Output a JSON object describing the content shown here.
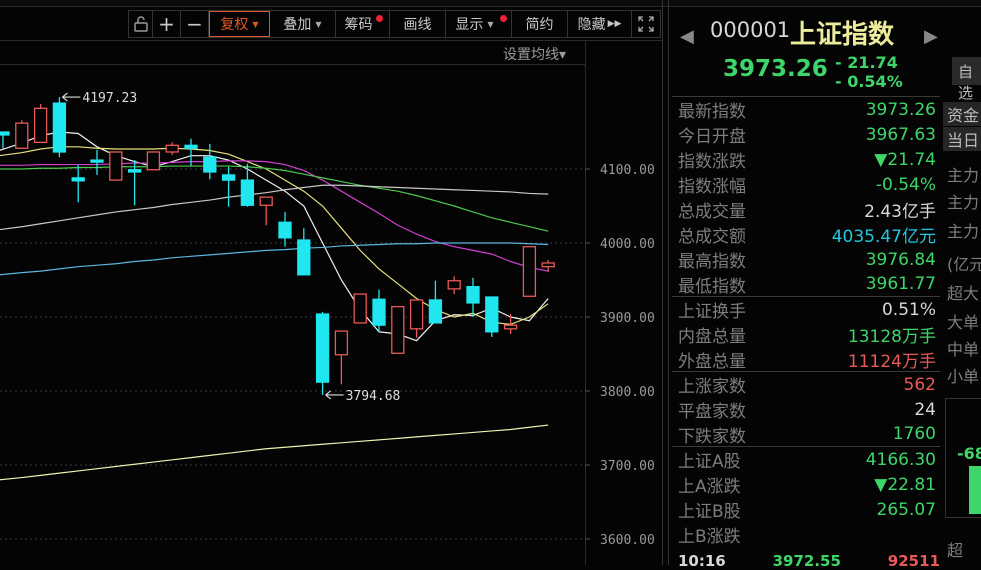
{
  "toolbar": {
    "lock_icon": "unlock-icon",
    "zoom_in": "+",
    "zoom_out": "−",
    "fuquan": "复权",
    "diejia": "叠加",
    "chouma": "筹码",
    "huaxian": "画线",
    "xianshi": "显示",
    "jianyue": "简约",
    "yincang": "隐藏",
    "fullscreen_icon": "expand-icon"
  },
  "set_ma": "设置均线▾",
  "quote": {
    "code": "000001",
    "name": "上证指数",
    "price": "3973.26",
    "change": "- 21.74",
    "change_pct": "- 0.54%",
    "zixuan": "自选"
  },
  "stats": [
    {
      "k": "最新指数",
      "v": "3973.26",
      "c": "g"
    },
    {
      "k": "今日开盘",
      "v": "3967.63",
      "c": "g"
    },
    {
      "k": "指数涨跌",
      "v": "▼21.74",
      "c": "g"
    },
    {
      "k": "指数涨幅",
      "v": "-0.54%",
      "c": "g"
    },
    {
      "k": "总成交量",
      "v": "2.43亿手",
      "c": "w"
    },
    {
      "k": "总成交额",
      "v": "4035.47亿元",
      "c": "c"
    },
    {
      "k": "最高指数",
      "v": "3976.84",
      "c": "g"
    },
    {
      "k": "最低指数",
      "v": "3961.77",
      "c": "g"
    },
    {
      "k": "上证换手",
      "v": "0.51%",
      "c": "w"
    },
    {
      "k": "内盘总量",
      "v": "13128万手",
      "c": "g"
    },
    {
      "k": "外盘总量",
      "v": "11124万手",
      "c": "r"
    },
    {
      "k": "上涨家数",
      "v": "562",
      "c": "r"
    },
    {
      "k": "平盘家数",
      "v": "24",
      "c": "w"
    },
    {
      "k": "下跌家数",
      "v": "1760",
      "c": "g"
    },
    {
      "k": "上证A股",
      "v": "4166.30",
      "c": "g"
    },
    {
      "k": "上A涨跌",
      "v": "▼22.81",
      "c": "g"
    },
    {
      "k": "上证B股",
      "v": "265.07",
      "c": "g"
    },
    {
      "k": "上B涨跌",
      "v": "",
      "c": "g"
    }
  ],
  "tick": {
    "time": "10:16",
    "price": "3972.55",
    "vol": "92511"
  },
  "far_column": [
    "资金",
    "当日",
    "主力",
    "主力",
    "主力",
    "(亿元",
    "超大",
    "大单",
    "中单",
    "小单",
    "-68",
    "超"
  ],
  "chart_data": {
    "type": "candlestick",
    "y_ticks": [
      "4100.00",
      "4000.00",
      "3900.00",
      "3800.00",
      "3700.00",
      "3600.00"
    ],
    "ylim": [
      3600,
      4100
    ],
    "annotations": [
      {
        "label": "4197.23",
        "index": 3,
        "value": 4197.23
      },
      {
        "label": "3794.68",
        "index": 17,
        "value": 3794.68
      }
    ],
    "ohlc": [
      [
        4150,
        4150,
        4128,
        4146
      ],
      [
        4128,
        4166,
        4128,
        4162
      ],
      [
        4136,
        4188,
        4136,
        4182
      ],
      [
        4189,
        4197.23,
        4116,
        4123
      ],
      [
        4088,
        4105,
        4055,
        4084
      ],
      [
        4112,
        4126,
        4092,
        4110
      ],
      [
        4085,
        4123,
        4085,
        4123
      ],
      [
        4099,
        4112,
        4051,
        4096
      ],
      [
        4099,
        4123,
        4099,
        4123
      ],
      [
        4123,
        4136,
        4119,
        4132
      ],
      [
        4132,
        4141,
        4104,
        4128
      ],
      [
        4116,
        4134,
        4086,
        4096
      ],
      [
        4092,
        4103,
        4049,
        4085
      ],
      [
        4085,
        4107,
        4049,
        4051
      ],
      [
        4051,
        4062,
        4024,
        4062
      ],
      [
        4028,
        4042,
        3995,
        4007
      ],
      [
        4004,
        4020,
        3957,
        3957
      ],
      [
        3904,
        3907,
        3794.68,
        3812
      ],
      [
        3849,
        3881,
        3809,
        3881
      ],
      [
        3892,
        3931,
        3892,
        3931
      ],
      [
        3924,
        3937,
        3880,
        3889
      ],
      [
        3851,
        3914,
        3851,
        3914
      ],
      [
        3884,
        3923,
        3872,
        3923
      ],
      [
        3923,
        3949,
        3892,
        3892
      ],
      [
        3938,
        3955,
        3931,
        3949
      ],
      [
        3941,
        3953,
        3900,
        3919
      ],
      [
        3927,
        3927,
        3873,
        3880
      ],
      [
        3884,
        3904,
        3877,
        3889
      ],
      [
        3928,
        3995,
        3928,
        3995
      ],
      [
        3968,
        3977,
        3961,
        3973
      ]
    ],
    "ma": [
      {
        "name": "MA5",
        "color": "#f2f2f2",
        "values": [
          4125,
          4135,
          4145,
          4150,
          4148,
          4130,
          4118,
          4110,
          4103,
          4110,
          4118,
          4118,
          4112,
          4100,
          4085,
          4070,
          4050,
          4000,
          3950,
          3910,
          3880,
          3877,
          3868,
          3895,
          3903,
          3902,
          3912,
          3900,
          3895,
          3925
        ]
      },
      {
        "name": "MA10",
        "color": "#e8e07a",
        "values": [
          4118,
          4122,
          4127,
          4130,
          4130,
          4128,
          4127,
          4127,
          4127,
          4128,
          4127,
          4125,
          4120,
          4110,
          4100,
          4085,
          4070,
          4050,
          4020,
          3990,
          3965,
          3945,
          3925,
          3910,
          3900,
          3905,
          3893,
          3890,
          3900,
          3918
        ]
      },
      {
        "name": "MA20",
        "color": "#d040d0",
        "values": [
          4105,
          4105,
          4106,
          4106,
          4106,
          4106,
          4107,
          4108,
          4108,
          4109,
          4110,
          4110,
          4111,
          4111,
          4110,
          4106,
          4098,
          4085,
          4070,
          4055,
          4040,
          4024,
          4012,
          4002,
          3995,
          3990,
          3985,
          3975,
          3967,
          3962
        ]
      },
      {
        "name": "MA30",
        "color": "#4ec850",
        "values": [
          4100,
          4100,
          4101,
          4101,
          4102,
          4102,
          4103,
          4103,
          4103,
          4104,
          4104,
          4104,
          4104,
          4103,
          4101,
          4098,
          4093,
          4088,
          4083,
          4078,
          4074,
          4070,
          4064,
          4057,
          4050,
          4042,
          4034,
          4028,
          4022,
          4016
        ]
      },
      {
        "name": "MA60",
        "color": "#c8c8c8",
        "values": [
          4018,
          4022,
          4026,
          4030,
          4034,
          4038,
          4042,
          4045,
          4048,
          4052,
          4055,
          4058,
          4062,
          4065,
          4068,
          4072,
          4075,
          4078,
          4078,
          4077,
          4076,
          4075,
          4074,
          4073,
          4072,
          4071,
          4070,
          4069,
          4067,
          4066
        ]
      },
      {
        "name": "MA120",
        "color": "#5ab8e0",
        "values": [
          3957,
          3960,
          3962,
          3965,
          3968,
          3970,
          3972,
          3975,
          3977,
          3980,
          3982,
          3984,
          3986,
          3988,
          3990,
          3991,
          3993,
          3994,
          3996,
          3997,
          3998,
          3999,
          3999,
          4000,
          4000,
          4000,
          4000,
          4000,
          3999,
          3998
        ]
      },
      {
        "name": "MA250",
        "color": "#f0f0b0",
        "values": [
          3680,
          3683,
          3686,
          3689,
          3692,
          3695,
          3698,
          3701,
          3704,
          3707,
          3710,
          3713,
          3716,
          3719,
          3722,
          3724,
          3726,
          3728,
          3730,
          3732,
          3734,
          3736,
          3738,
          3740,
          3742,
          3744,
          3746,
          3748,
          3751,
          3754
        ]
      }
    ],
    "up_color": "#e85a5a",
    "down_color": "#20e6f0"
  }
}
